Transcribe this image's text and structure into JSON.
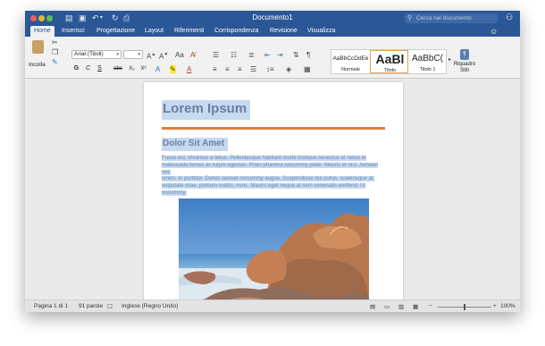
{
  "window": {
    "title": "Documento1",
    "search_placeholder": "Cerca nel documento"
  },
  "tabs": [
    "Home",
    "Inserisci",
    "Progettazione",
    "Layout",
    "Riferimenti",
    "Corrispondenza",
    "Revisione",
    "Visualizza"
  ],
  "ribbon": {
    "paste_label": "Incolla",
    "font_name": "Arial (Titoli)",
    "font_size": "",
    "format_buttons": [
      "G",
      "C",
      "S",
      "abc",
      "X₂",
      "X²"
    ],
    "styles": [
      {
        "sample": "AaBbCcDdEe",
        "name": "Normale"
      },
      {
        "sample": "AaBl",
        "name": "Titolo"
      },
      {
        "sample": "AaBbC(",
        "name": "Titolo 1"
      }
    ],
    "styles_pane_label_line1": "Riquadro",
    "styles_pane_label_line2": "Stili"
  },
  "document": {
    "heading1": "Lorem Ipsum",
    "heading2": "Dolor Sit Amet",
    "body_lines": [
      "Fusce est. Vivamus a tellus. Pellentesque habitant morbi tristique senectus et netus et",
      "malesuada fames ac turpis egestas. Proin pharetra nonummy pede. Mauris et orci. Aenean nec",
      "lorem. In porttitor. Donec laoreet nonummy augue. Suspendisse dui purus, scelerisque at,",
      "vulputate vitae, pretium mattis, nunc. Mauris eget neque at sem venenatis eleifend. Ut",
      "nonummy."
    ]
  },
  "status": {
    "page": "Pagina 1 di 1",
    "words": "91 parole",
    "language": "Inglese (Regno Unito)",
    "zoom": "100%",
    "zoom_value": 1.0
  },
  "colors": {
    "title_bar": "#2b5797",
    "heading_text": "#6b7fa2",
    "accent_rule": "#e07b39",
    "selection": "#c6d9f1"
  }
}
